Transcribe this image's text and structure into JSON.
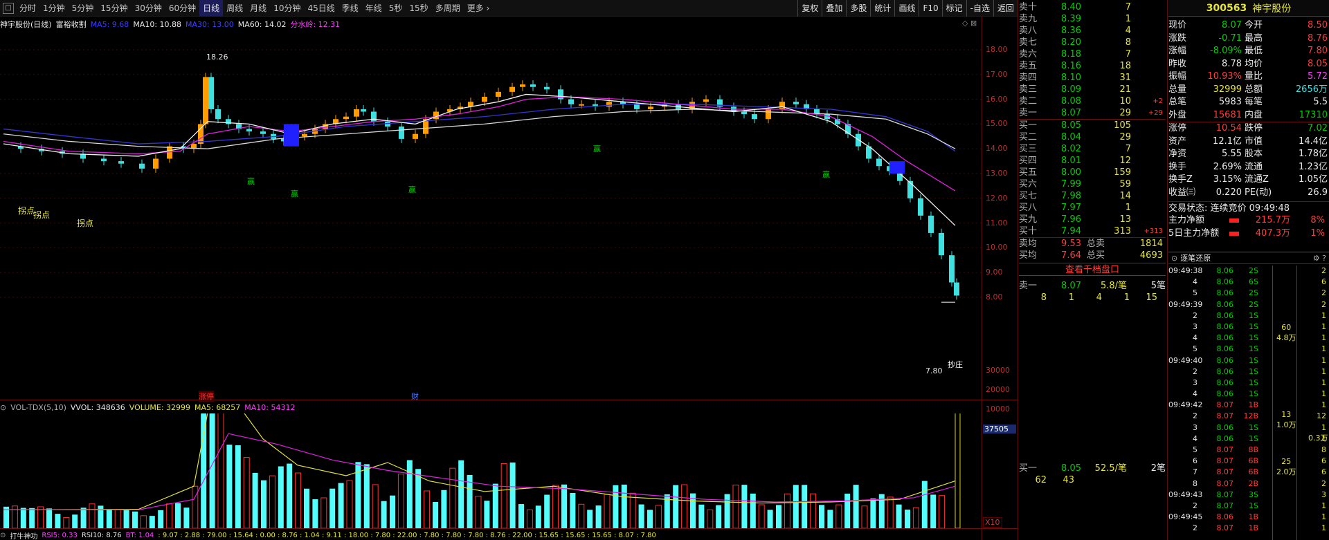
{
  "toolbar": {
    "periods": [
      "分时",
      "1分钟",
      "5分钟",
      "15分钟",
      "30分钟",
      "60分钟",
      "日线",
      "周线",
      "月线",
      "10分钟",
      "45日线",
      "季线",
      "年线",
      "5秒",
      "15秒",
      "多周期",
      "更多 ›"
    ],
    "active": "日线",
    "right": [
      "复权",
      "叠加",
      "多股",
      "统计",
      "画线",
      "F10",
      "标记",
      "-自选",
      "返回"
    ]
  },
  "main_legend": {
    "name": "神宇股份(日线)",
    "indicator": "富裕收割",
    "ma5": "MA5: 9.68",
    "ma10": "MA10: 10.88",
    "ma30": "MA30: 13.00",
    "ma60": "MA60: 14.02",
    "fsl": "分水岭: 12.31"
  },
  "price_axis": [
    "18.00",
    "17.00",
    "16.00",
    "15.00",
    "14.00",
    "13.00",
    "12.00",
    "11.00",
    "10.00",
    "9.00",
    "8.00"
  ],
  "annotations": {
    "high": "18.26",
    "low": "7.80",
    "guaidian": "拐点",
    "zhang": "涨停",
    "cai": "财",
    "buy": "赢",
    "last": "抄庄"
  },
  "vol_legend": {
    "name": "VOL-TDX(5,10)",
    "vvol": "VVOL: 348636",
    "volume": "VOLUME: 32999",
    "ma5": "MA5: 68257",
    "ma10": "MA10: 54312"
  },
  "vol_axis": [
    "30000",
    "20000",
    "10000"
  ],
  "vol_cur": "37505",
  "vol_unit": "X10",
  "bottom_legend": {
    "name": "打牛神功",
    "rsi5": "RSI5: 0.33",
    "rsi10": "RSI10: 8.76",
    "bt": "BT: 1.04",
    "rest": ": 9.07 : 2.88 : 79.00 : 15.64 : 0.00 : 8.76 : 1.04 : 9.11 : 18.00 : 7.80 : 22.00 : 7.80 : 7.80 : 7.80 : 8.76 : 22.00 : 15.65 : 15.65 : 15.65 : 8.07 : 7.80"
  },
  "orderbook": {
    "sells": [
      [
        "卖十",
        "8.40",
        "7",
        ""
      ],
      [
        "卖九",
        "8.39",
        "1",
        ""
      ],
      [
        "卖八",
        "8.36",
        "4",
        ""
      ],
      [
        "卖七",
        "8.20",
        "8",
        ""
      ],
      [
        "卖六",
        "8.18",
        "7",
        ""
      ],
      [
        "卖五",
        "8.16",
        "18",
        ""
      ],
      [
        "卖四",
        "8.10",
        "31",
        ""
      ],
      [
        "卖三",
        "8.09",
        "21",
        ""
      ],
      [
        "卖二",
        "8.08",
        "10",
        "+2"
      ],
      [
        "卖一",
        "8.07",
        "29",
        "+29"
      ]
    ],
    "buys": [
      [
        "买一",
        "8.05",
        "105",
        ""
      ],
      [
        "买二",
        "8.04",
        "29",
        ""
      ],
      [
        "买三",
        "8.02",
        "7",
        ""
      ],
      [
        "买四",
        "8.01",
        "12",
        ""
      ],
      [
        "买五",
        "8.00",
        "159",
        ""
      ],
      [
        "买六",
        "7.99",
        "59",
        ""
      ],
      [
        "买七",
        "7.98",
        "14",
        ""
      ],
      [
        "买八",
        "7.97",
        "1",
        ""
      ],
      [
        "买九",
        "7.96",
        "13",
        ""
      ],
      [
        "买十",
        "7.94",
        "313",
        "+313"
      ]
    ],
    "avg_sell": [
      "卖均",
      "9.53",
      "总卖",
      "1814"
    ],
    "avg_buy": [
      "买均",
      "7.64",
      "总买",
      "4693"
    ],
    "view_btn": "查看千档盘口",
    "sell1": [
      "卖一",
      "8.07",
      "5.8/笔",
      "5笔"
    ],
    "sell1_detail": [
      "8",
      "1",
      "4",
      "1",
      "15"
    ],
    "buy1": [
      "买一",
      "8.05",
      "52.5/笔",
      "2笔"
    ],
    "buy1_detail": [
      "62",
      "43"
    ]
  },
  "quote": {
    "code": "300563",
    "name": "神宇股份",
    "rows": [
      [
        "现价",
        "8.07",
        "今开",
        "8.50"
      ],
      [
        "涨跌",
        "-0.71",
        "最高",
        "8.76"
      ],
      [
        "涨幅",
        "-8.09%",
        "最低",
        "7.80"
      ],
      [
        "昨收",
        "8.78",
        "均价",
        "8.05"
      ],
      [
        "振幅",
        "10.93%",
        "量比",
        "5.72"
      ],
      [
        "总量",
        "32999",
        "总额",
        "2656万"
      ],
      [
        "总笔",
        "5983",
        "每笔",
        "5.5"
      ],
      [
        "外盘",
        "15681",
        "内盘",
        "17310"
      ],
      [
        "涨停",
        "10.54",
        "跌停",
        "7.02"
      ],
      [
        "资产",
        "12.1亿",
        "市值",
        "14.4亿"
      ],
      [
        "净资",
        "5.55",
        "股本",
        "1.78亿"
      ],
      [
        "换手",
        "2.69%",
        "流通",
        "1.23亿"
      ],
      [
        "换手Z",
        "3.15%",
        "流通Z",
        "1.05亿"
      ],
      [
        "收益㈢",
        "0.220",
        "PE(动)",
        "26.9"
      ]
    ],
    "trade_state": "交易状态: 连续竞价 09:49:48",
    "flow1": [
      "主力净额",
      "215.7万",
      "8%"
    ],
    "flow2": [
      "5日主力净额",
      "407.3万",
      "1%"
    ]
  },
  "ticks_title": "逐笔还原",
  "ticks": [
    [
      "09:49:38",
      "8.06",
      "2S",
      "2"
    ],
    [
      "4",
      "8.06",
      "6S",
      "6"
    ],
    [
      "5",
      "8.06",
      "2S",
      "2"
    ],
    [
      "09:49:39",
      "8.06",
      "2S",
      "2"
    ],
    [
      "2",
      "8.06",
      "1S",
      "1"
    ],
    [
      "3",
      "8.06",
      "1S",
      "1"
    ],
    [
      "4",
      "8.06",
      "1S",
      "1"
    ],
    [
      "5",
      "8.06",
      "1S",
      "1"
    ],
    [
      "09:49:40",
      "8.06",
      "1S",
      "1"
    ],
    [
      "2",
      "8.06",
      "1S",
      "1"
    ],
    [
      "3",
      "8.06",
      "1S",
      "1"
    ],
    [
      "4",
      "8.06",
      "1S",
      "1"
    ],
    [
      "09:49:42",
      "8.07",
      "1B",
      "1"
    ],
    [
      "2",
      "8.07",
      "12B",
      "12"
    ],
    [
      "3",
      "8.06",
      "1S",
      "1"
    ],
    [
      "4",
      "8.06",
      "1S",
      "1"
    ],
    [
      "5",
      "8.07",
      "8B",
      "8"
    ],
    [
      "6",
      "8.07",
      "6B",
      "6"
    ],
    [
      "7",
      "8.07",
      "6B",
      "6"
    ],
    [
      "8",
      "8.07",
      "2B",
      "2"
    ],
    [
      "09:49:43",
      "8.07",
      "3S",
      "3"
    ],
    [
      "2",
      "8.07",
      "1S",
      "1"
    ],
    [
      "09:49:45",
      "8.06",
      "1B",
      "1"
    ],
    [
      "2",
      "8.07",
      "1B",
      "1"
    ]
  ],
  "tick_groups": [
    [
      "60",
      "4.8万"
    ],
    [
      "13",
      "1.0万"
    ],
    [
      "25",
      "2.0万"
    ],
    [
      "0.3万",
      ""
    ]
  ]
}
